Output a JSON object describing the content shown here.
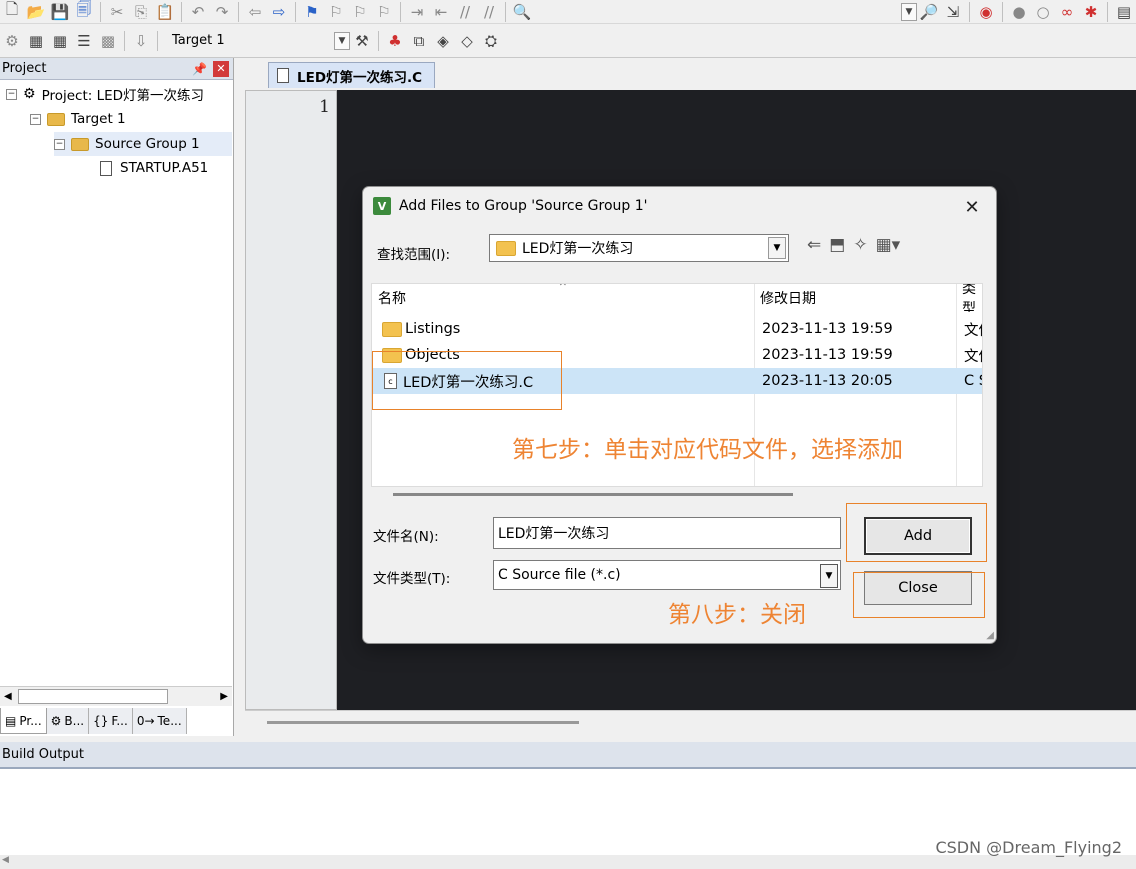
{
  "toolbar": {
    "target_name": "Target 1"
  },
  "project_panel": {
    "title": "Project",
    "pin": "p",
    "close": "x",
    "tree": {
      "project": "Project: LED灯第一次练习",
      "target": "Target 1",
      "group": "Source Group 1",
      "file": "STARTUP.A51"
    },
    "tabs": [
      {
        "label": "Pr..."
      },
      {
        "label": "B..."
      },
      {
        "label": "F..."
      },
      {
        "label": "Te..."
      }
    ]
  },
  "editor": {
    "tab_label": "LED灯第一次练习.C",
    "line_number": "1"
  },
  "build_output": {
    "title": "Build Output"
  },
  "dialog": {
    "title": "Add Files to Group 'Source Group 1'",
    "look_in_label": "查找范围(I):",
    "look_in_value": "LED灯第一次练习",
    "columns": {
      "name": "名称",
      "date": "修改日期",
      "type": "类型"
    },
    "files": [
      {
        "name": "Listings",
        "date": "2023-11-13 19:59",
        "type": "文件夹",
        "kind": "folder"
      },
      {
        "name": "Objects",
        "date": "2023-11-13 19:59",
        "type": "文件夹",
        "kind": "folder"
      },
      {
        "name": "LED灯第一次练习.C",
        "date": "2023-11-13 20:05",
        "type": "C Source",
        "kind": "c-file",
        "selected": true
      }
    ],
    "filename_label": "文件名(N):",
    "filename_value": "LED灯第一次练习",
    "filetype_label": "文件类型(T):",
    "filetype_value": "C Source file (*.c)",
    "add_button": "Add",
    "close_button": "Close"
  },
  "annotations": {
    "step7": "第七步：单击对应代码文件，选择添加",
    "step8": "第八步：关闭",
    "color": "#ee8433"
  },
  "watermark": "CSDN @Dream_Flying2",
  "colors": {
    "editor_bg": "#1e1f23",
    "selection": "#cce4f7",
    "panel_header": "#dde3ec"
  }
}
